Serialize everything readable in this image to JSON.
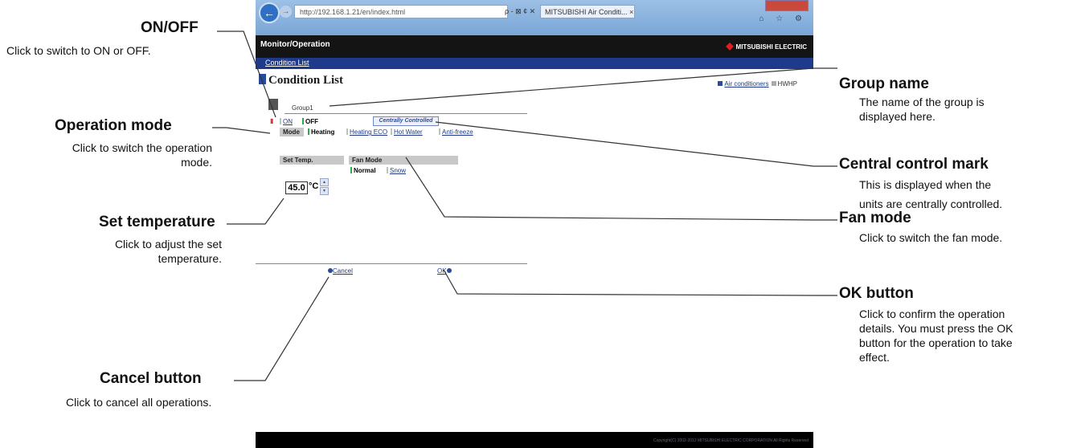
{
  "browser": {
    "url": "http://192.168.1.21/en/index.html",
    "address_controls": "ρ - ⊠ ¢ ✕",
    "tab_title": "MITSUBISHI Air Conditi... ×",
    "nav_icons": "⌂ ☆ ⚙"
  },
  "app": {
    "title": "Monitor/Operation",
    "logo": "MITSUBISHI ELECTRIC",
    "nav_link": "Condition List",
    "page_title": "Condition List",
    "filter": {
      "air_conditioners": "Air conditioners",
      "hwhp": "HWHP"
    },
    "group_name": "Group1",
    "on_label": "ON",
    "off_label": "OFF",
    "central_control": "Centrally Controlled",
    "mode_label": "Mode",
    "modes": [
      "Heating",
      "Heating ECO",
      "Hot Water",
      "Anti-freeze"
    ],
    "set_temp_label": "Set Temp.",
    "set_temp_value": "45.0",
    "set_temp_unit": "°C",
    "fan_mode_label": "Fan Mode",
    "fan_modes": [
      "Normal",
      "Snow"
    ],
    "cancel": "Cancel",
    "ok": "OK",
    "footer": "Copyright(C) 2002-2012 MITSUBISHI ELECTRIC CORPORATION All Rights Reserved"
  },
  "annotations": {
    "on_off": {
      "title": "ON/OFF",
      "desc": "Click to switch to ON or OFF."
    },
    "operation_mode": {
      "title": "Operation mode",
      "desc_line1": "Click to switch the operation",
      "desc_line2": "mode."
    },
    "set_temperature": {
      "title": "Set temperature",
      "desc_line1": "Click to adjust the set",
      "desc_line2": "temperature."
    },
    "cancel_button": {
      "title": "Cancel button",
      "desc": "Click to cancel all operations."
    },
    "group_name": {
      "title": "Group name",
      "desc_line1": "The name of the group is",
      "desc_line2": "displayed here."
    },
    "central_control": {
      "title": "Central control mark",
      "desc_line1": "This is displayed when the",
      "desc_line2": "units are centrally controlled."
    },
    "fan_mode": {
      "title": "Fan mode",
      "desc": "Click to switch the fan mode."
    },
    "ok_button": {
      "title": "OK button",
      "desc_line1": "Click to confirm the operation",
      "desc_line2": "details. You must press the OK",
      "desc_line3": "button for the operation to take",
      "desc_line4": "effect."
    }
  }
}
